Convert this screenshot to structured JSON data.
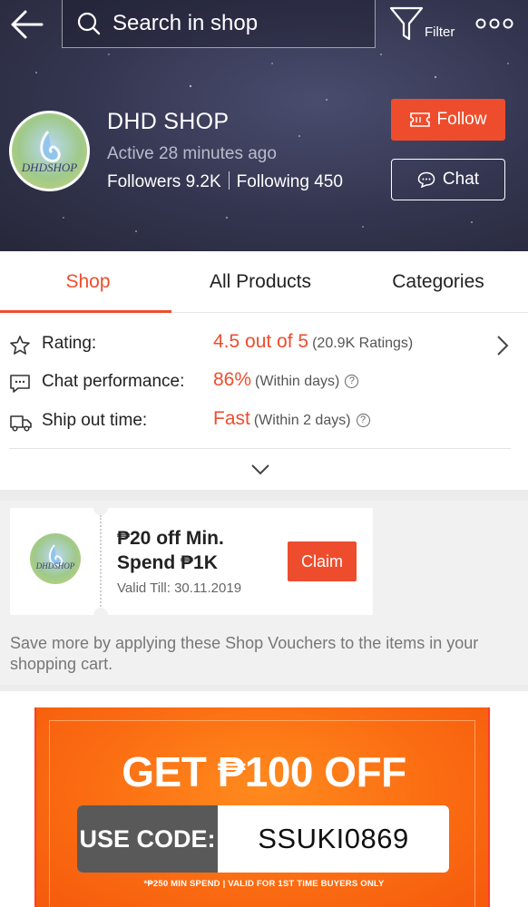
{
  "topbar": {
    "search_placeholder": "Search in shop",
    "filter_label": "Filter"
  },
  "shop": {
    "name": "DHD SHOP",
    "active_status": "Active 28 minutes ago",
    "followers": "Followers 9.2K",
    "following": "Following 450",
    "avatar_text": "DHDSHOP",
    "follow_label": "Follow",
    "chat_label": "Chat"
  },
  "tabs": [
    {
      "label": "Shop",
      "active": true
    },
    {
      "label": "All Products",
      "active": false
    },
    {
      "label": "Categories",
      "active": false
    }
  ],
  "info": {
    "rating": {
      "label": "Rating:",
      "value": "4.5 out of 5",
      "sub": "(20.9K Ratings)",
      "stars": 4.5
    },
    "chat_performance": {
      "label": "Chat performance:",
      "value": "86%",
      "sub": "(Within days)"
    },
    "ship_out": {
      "label": "Ship out time:",
      "value": "Fast",
      "sub": "(Within 2 days)"
    }
  },
  "voucher": {
    "title": "₱20 off Min. Spend ₱1K",
    "valid": "Valid Till: 30.11.2019",
    "claim_label": "Claim",
    "logo_text": "DHDSHOP",
    "note": "Save more by applying these Shop Vouchers to the items in your shopping cart."
  },
  "banner": {
    "headline": "GET ₱100 OFF",
    "code_label": "USE CODE:",
    "code_value": "SSUKI0869",
    "fine_print": "*₱250 MIN SPEND | VALID FOR 1ST TIME BUYERS ONLY"
  },
  "colors": {
    "accent": "#ee4d2d",
    "header_bg": "#33354f",
    "banner_orange": "#fb6c12",
    "code_label_bg": "#595959"
  }
}
